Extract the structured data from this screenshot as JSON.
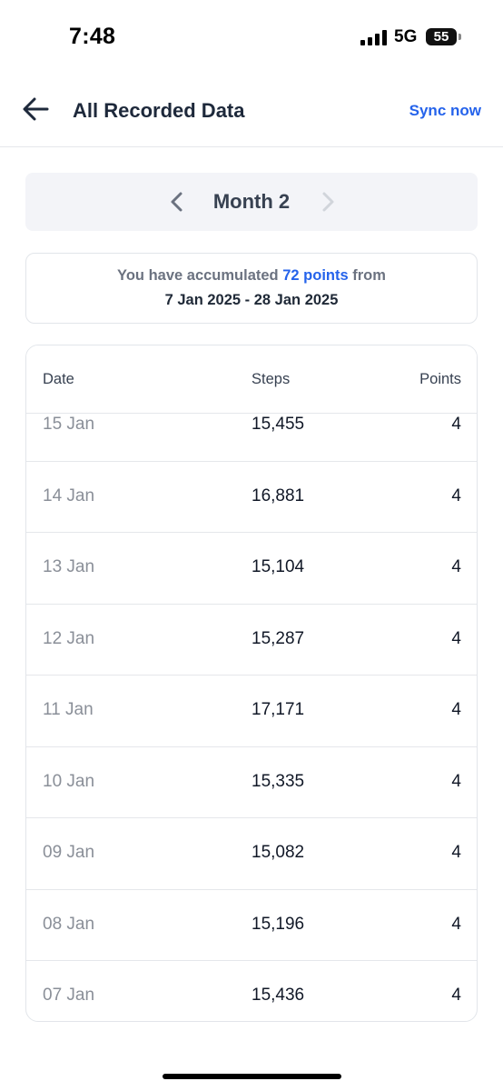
{
  "status_bar": {
    "time": "7:48",
    "network": "5G",
    "battery": "55"
  },
  "header": {
    "title": "All Recorded Data",
    "sync_label": "Sync now"
  },
  "month_nav": {
    "label": "Month 2"
  },
  "summary": {
    "prefix": "You have accumulated",
    "points": "72 points",
    "suffix": "from",
    "date_range": "7 Jan 2025 - 28 Jan 2025"
  },
  "table": {
    "headers": {
      "date": "Date",
      "steps": "Steps",
      "points": "Points"
    },
    "rows": [
      {
        "date": "15 Jan",
        "steps": "15,455",
        "points": "4"
      },
      {
        "date": "14 Jan",
        "steps": "16,881",
        "points": "4"
      },
      {
        "date": "13 Jan",
        "steps": "15,104",
        "points": "4"
      },
      {
        "date": "12 Jan",
        "steps": "15,287",
        "points": "4"
      },
      {
        "date": "11 Jan",
        "steps": "17,171",
        "points": "4"
      },
      {
        "date": "10 Jan",
        "steps": "15,335",
        "points": "4"
      },
      {
        "date": "09 Jan",
        "steps": "15,082",
        "points": "4"
      },
      {
        "date": "08 Jan",
        "steps": "15,196",
        "points": "4"
      },
      {
        "date": "07 Jan",
        "steps": "15,436",
        "points": "4"
      }
    ]
  },
  "colors": {
    "accent": "#2563eb",
    "title": "#1e293b",
    "muted": "#8a8f98",
    "nav_bg": "#f3f4f8"
  },
  "icons": {
    "back": "arrow-left-icon",
    "prev": "chevron-left-icon",
    "next": "chevron-right-icon",
    "signal": "cellular-signal-icon",
    "battery": "battery-icon"
  }
}
